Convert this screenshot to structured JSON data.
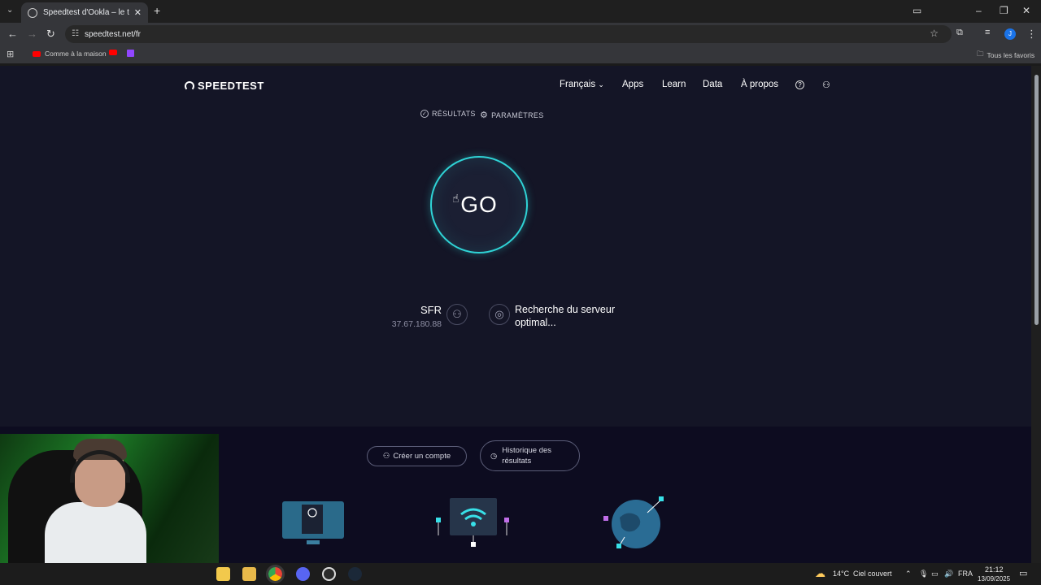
{
  "browser": {
    "tab_title": "Speedtest d'Ookla – le test de v",
    "tab_close": "✕",
    "new_tab": "+",
    "url": "speedtest.net/fr",
    "bookmarks": [
      {
        "label": "Comme à la maison"
      }
    ],
    "all_favorites": "Tous les favoris",
    "profile_initial": "J"
  },
  "site": {
    "logo": "SPEEDTEST",
    "nav": {
      "language": "Français",
      "apps": "Apps",
      "learn": "Learn",
      "data": "Data",
      "about": "À propos"
    },
    "subnav": {
      "results": "RÉSULTATS",
      "settings": "PARAMÈTRES"
    },
    "go_button": "GO",
    "isp": {
      "name": "SFR",
      "ip": "37.67.180.88"
    },
    "server_status": "Recherche du serveur optimal...",
    "create_account": "Créer un compte",
    "history": "Historique des résultats"
  },
  "taskbar": {
    "weather_temp": "14°C",
    "weather_desc": "Ciel couvert",
    "language": "FRA",
    "time": "21:12",
    "date": "13/09/2025"
  },
  "colors": {
    "page_bg": "#141526",
    "lower_bg": "#0d0c20",
    "go_ring": "#2fd3d6"
  }
}
